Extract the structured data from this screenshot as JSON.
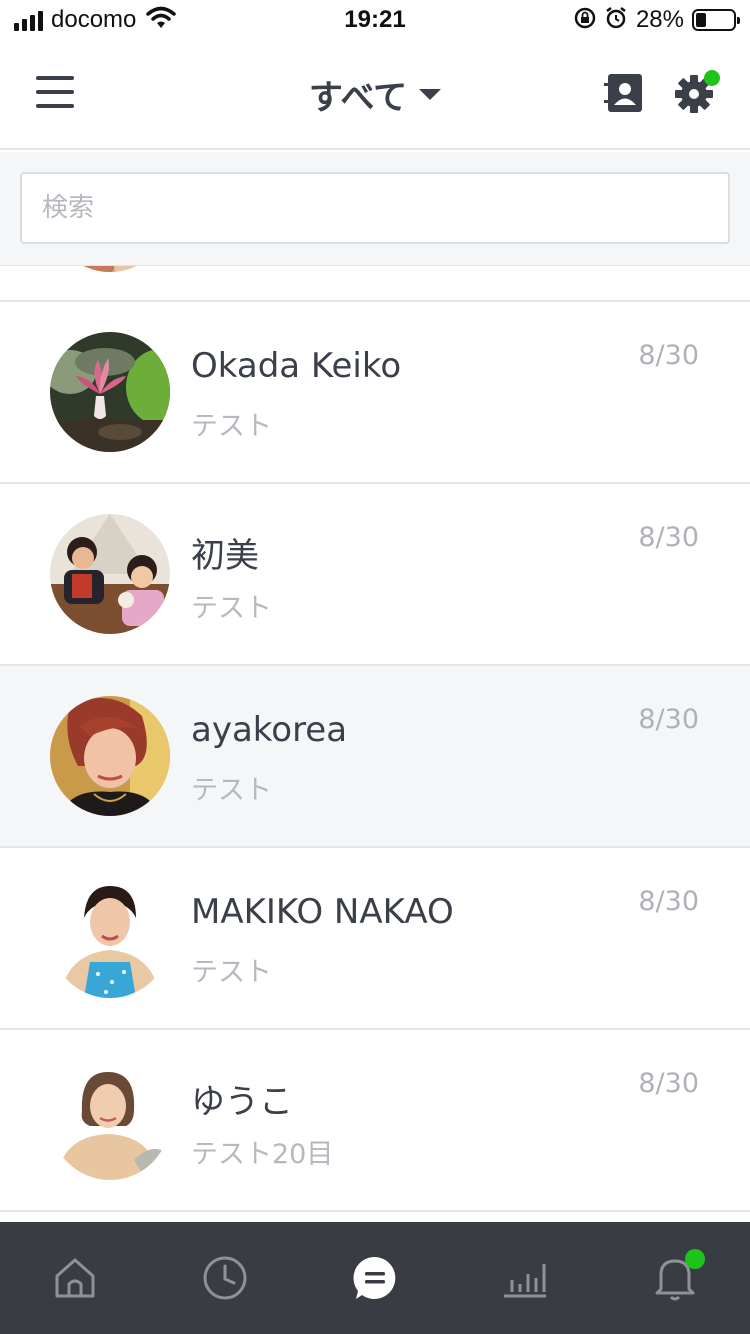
{
  "status_bar": {
    "carrier": "docomo",
    "time": "19:21",
    "battery_percent": "28%",
    "battery_level": 0.28,
    "icons": [
      "signal-icon",
      "wifi-icon",
      "rotation-lock-icon",
      "alarm-icon",
      "battery-icon"
    ]
  },
  "header": {
    "filter_label": "すべて",
    "menu_icon": "hamburger-icon",
    "contacts_icon": "contacts-icon",
    "settings_icon": "gear-icon",
    "settings_badge_color": "#1fc41a"
  },
  "search": {
    "placeholder": "検索",
    "value": ""
  },
  "chats": [
    {
      "name": "Okada  Keiko",
      "preview": "テスト",
      "date": "8/30",
      "selected": false
    },
    {
      "name": "初美",
      "preview": "テスト",
      "date": "8/30",
      "selected": false
    },
    {
      "name": "ayakorea",
      "preview": "テスト",
      "date": "8/30",
      "selected": true
    },
    {
      "name": "MAKIKO NAKAO",
      "preview": "テスト",
      "date": "8/30",
      "selected": false
    },
    {
      "name": "ゆうこ",
      "preview": "テスト20目",
      "date": "8/30",
      "selected": false
    }
  ],
  "tabbar": {
    "tabs": [
      {
        "icon": "home-icon",
        "active": false
      },
      {
        "icon": "clock-icon",
        "active": false
      },
      {
        "icon": "chat-icon",
        "active": true
      },
      {
        "icon": "stats-icon",
        "active": false
      },
      {
        "icon": "bell-icon",
        "active": false,
        "badge": true
      }
    ],
    "background": "#393c43",
    "badge_color": "#1fc41a"
  }
}
